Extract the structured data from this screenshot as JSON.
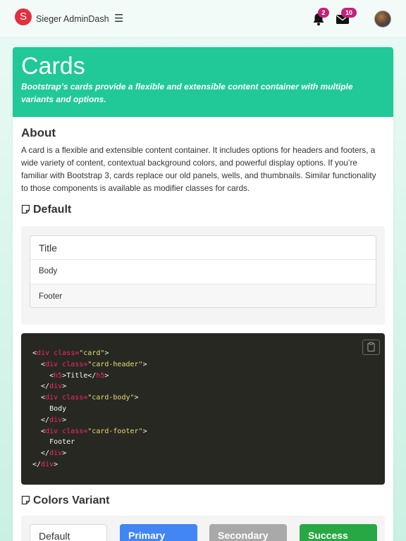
{
  "navbar": {
    "logo_letter": "S",
    "brand": "Sieger AdminDash",
    "menu_icon": "hamburger-icon",
    "notifications_count": "2",
    "messages_count": "10",
    "colors": {
      "logo": "#e2303f",
      "badge": "#c2227a"
    }
  },
  "hero": {
    "title": "Cards",
    "subtitle": "Bootstrap’s cards provide a flexible and extensible content container with multiple variants and options.",
    "color": "#20c997"
  },
  "about": {
    "heading": "About",
    "text": "A card is a flexible and extensible content container. It includes options for headers and footers, a wide variety of content, contextual background colors, and powerful display options. If you’re familiar with Bootstrap 3, cards replace our old panels, wells, and thumbnails. Similar functionality to those components is available as modifier classes for cards."
  },
  "default_section": {
    "heading": "Default",
    "icon": "sticky-note-icon",
    "example": {
      "header": "Title",
      "body": "Body",
      "footer": "Footer"
    }
  },
  "code_sample": {
    "copy_icon": "clipboard-icon",
    "lines": [
      {
        "t1": "<",
        "tag": "div",
        "attr": " class=",
        "val": "\"card\"",
        "t2": ">",
        "text": ""
      },
      {
        "t1": "  <",
        "tag": "div",
        "attr": " class=",
        "val": "\"card-header\"",
        "t2": ">",
        "text": ""
      },
      {
        "t1": "    <",
        "tag": "h5",
        "attr": "",
        "val": "",
        "t2": ">",
        "text": "Title",
        "close": "h5"
      },
      {
        "t1": "  </",
        "tag": "div",
        "attr": "",
        "val": "",
        "t2": ">",
        "text": ""
      },
      {
        "t1": "  <",
        "tag": "div",
        "attr": " class=",
        "val": "\"card-body\"",
        "t2": ">",
        "text": ""
      },
      {
        "plain": "    Body"
      },
      {
        "t1": "  </",
        "tag": "div",
        "attr": "",
        "val": "",
        "t2": ">",
        "text": ""
      },
      {
        "t1": "  <",
        "tag": "div",
        "attr": " class=",
        "val": "\"card-footer\"",
        "t2": ">",
        "text": ""
      },
      {
        "plain": "    Footer"
      },
      {
        "t1": "  </",
        "tag": "div",
        "attr": "",
        "val": "",
        "t2": ">",
        "text": ""
      },
      {
        "t1": "</",
        "tag": "div",
        "attr": "",
        "val": "",
        "t2": ">",
        "text": ""
      }
    ]
  },
  "colors_section": {
    "heading": "Colors Variant",
    "icon": "sticky-note-icon",
    "variants": [
      {
        "label": "Default",
        "color": "#ffffff"
      },
      {
        "label": "Primary",
        "color": "#4285f4"
      },
      {
        "label": "Secondary",
        "color": "#a9a9a9"
      },
      {
        "label": "Success",
        "color": "#28a745"
      }
    ]
  }
}
